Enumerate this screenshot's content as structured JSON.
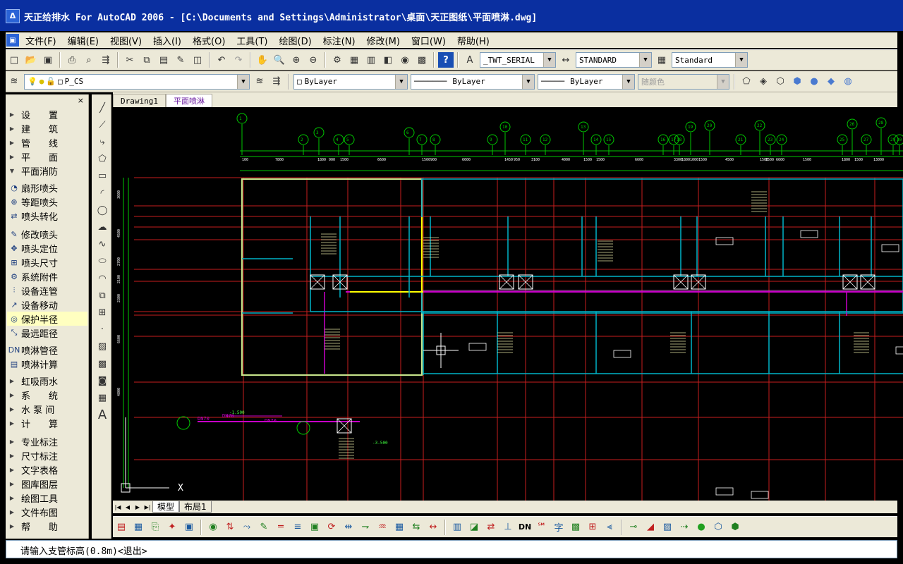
{
  "window": {
    "title": "天正给排水 For AutoCAD 2006 - [C:\\Documents and Settings\\Administrator\\桌面\\天正图纸\\平面喷淋.dwg]",
    "app_icon": "tangent-app-icon"
  },
  "menu": [
    "文件(F)",
    "编辑(E)",
    "视图(V)",
    "插入(I)",
    "格式(O)",
    "工具(T)",
    "绘图(D)",
    "标注(N)",
    "修改(M)",
    "窗口(W)",
    "帮助(H)"
  ],
  "toolbar1": {
    "textstyle": "_TWT_SERIAL",
    "dimstyle": "STANDARD",
    "tablestyle": "Standard"
  },
  "toolbar2": {
    "layer": "P_CS",
    "color": "ByLayer",
    "linetype": "ByLayer",
    "lineweight": "ByLayer",
    "plotstyle": "随颜色"
  },
  "panel": {
    "close": "×",
    "items": [
      {
        "label": "设　　置",
        "type": "arrow"
      },
      {
        "label": "建　　筑",
        "type": "arrow"
      },
      {
        "label": "管　　线",
        "type": "arrow"
      },
      {
        "label": "平　　面",
        "type": "arrow"
      },
      {
        "label": "平面消防",
        "type": "open"
      },
      {
        "label": "扇形喷头",
        "type": "icon",
        "icon": "sector-sprinkler-icon",
        "glyph": "◔"
      },
      {
        "label": "等距喷头",
        "type": "icon",
        "icon": "equidistant-sprinkler-icon",
        "glyph": "⊕"
      },
      {
        "label": "喷头转化",
        "type": "icon",
        "icon": "sprinkler-convert-icon",
        "glyph": "⇄"
      },
      {
        "label": "修改喷头",
        "type": "icon",
        "icon": "edit-sprinkler-icon",
        "glyph": "✎"
      },
      {
        "label": "喷头定位",
        "type": "icon",
        "icon": "sprinkler-locate-icon",
        "glyph": "✥"
      },
      {
        "label": "喷头尺寸",
        "type": "icon",
        "icon": "sprinkler-dimension-icon",
        "glyph": "⊞"
      },
      {
        "label": "系统附件",
        "type": "icon",
        "icon": "system-accessory-icon",
        "glyph": "⚙"
      },
      {
        "label": "设备连管",
        "type": "icon",
        "icon": "equipment-connect-icon",
        "glyph": "⫶"
      },
      {
        "label": "设备移动",
        "type": "icon",
        "icon": "equipment-move-icon",
        "glyph": "↗"
      },
      {
        "label": "保护半径",
        "type": "icon",
        "icon": "protection-radius-icon",
        "glyph": "◎",
        "highlight": true
      },
      {
        "label": "最远距径",
        "type": "icon",
        "icon": "farthest-distance-icon",
        "glyph": "⤡"
      },
      {
        "label": "喷淋管径",
        "type": "icon",
        "icon": "sprinkler-pipe-diameter-icon",
        "glyph": "DN"
      },
      {
        "label": "喷淋计算",
        "type": "icon",
        "icon": "sprinkler-calc-icon",
        "glyph": "▤"
      },
      {
        "label": "虹吸雨水",
        "type": "arrow"
      },
      {
        "label": "系　　统",
        "type": "arrow"
      },
      {
        "label": "水 泵 间",
        "type": "arrow"
      },
      {
        "label": "计　　算",
        "type": "arrow"
      },
      {
        "label": "专业标注",
        "type": "arrow"
      },
      {
        "label": "尺寸标注",
        "type": "arrow"
      },
      {
        "label": "文字表格",
        "type": "arrow"
      },
      {
        "label": "图库图层",
        "type": "arrow"
      },
      {
        "label": "绘图工具",
        "type": "arrow"
      },
      {
        "label": "文件布图",
        "type": "arrow"
      },
      {
        "label": "帮　　助",
        "type": "arrow"
      }
    ]
  },
  "doc_tabs": [
    {
      "label": "Drawing1",
      "active": false
    },
    {
      "label": "平面喷淋",
      "active": true
    }
  ],
  "layout_tabs": [
    {
      "label": "模型",
      "active": true
    },
    {
      "label": "布局1",
      "active": false
    }
  ],
  "command_line": "请输入支管标高(0.8m)<退出>",
  "drawing": {
    "axis_top": [
      "1-1",
      "1-2",
      "1-3",
      "1-4",
      "1-5",
      "1-6",
      "1-7",
      "1-8",
      "1-9",
      "1-10",
      "1-11",
      "1-12",
      "1-13",
      "1-14",
      "1-15",
      "1-16",
      "1-17",
      "1-18",
      "1-19",
      "1-20",
      "1-21",
      "1-22",
      "1-23",
      "1-24",
      "1-25",
      "1-26",
      "1-27",
      "1-28",
      "1-29",
      "1-30"
    ],
    "dims_top": [
      "100",
      "7800",
      "1800",
      "900",
      "1500",
      "6600",
      "1500",
      "900",
      "6600",
      "1450",
      "950",
      "3100",
      "4000",
      "1500",
      "1500",
      "6600",
      "3300",
      "1800",
      "1000",
      "1500",
      "4500",
      "1500",
      "1500",
      "6600",
      "1500",
      "1800",
      "1500",
      "13000"
    ],
    "dims_left": [
      "3600",
      "4500",
      "2700",
      "2100",
      "2300",
      "6600",
      "4800"
    ],
    "pipe_labels": [
      "DN70",
      "DN70",
      "DN70",
      "-1.500",
      "-3.500"
    ],
    "colors": {
      "axis": "#00c800",
      "wall": "#00b4c8",
      "column": "#c81e1e",
      "pipe": "#c800c8",
      "hatch": "#ffff00"
    }
  }
}
